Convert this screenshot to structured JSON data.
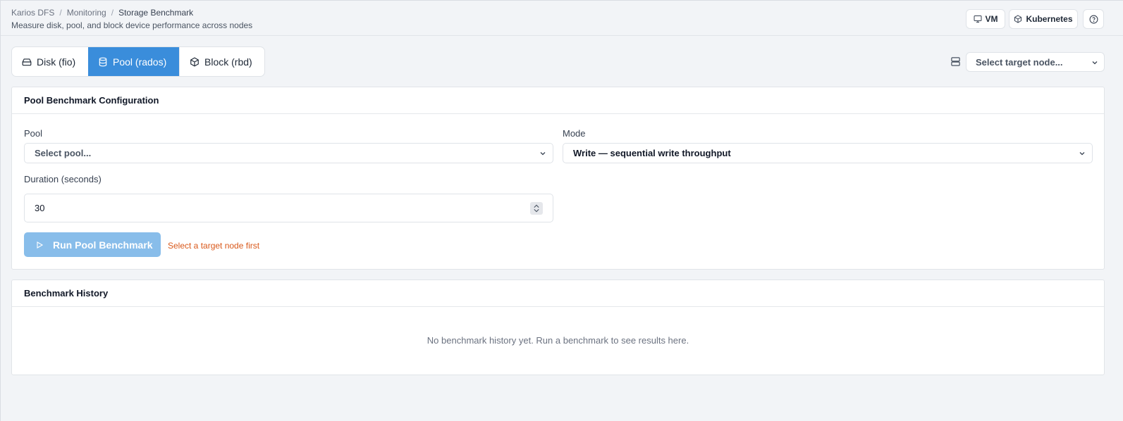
{
  "header": {
    "breadcrumb": [
      "Karios DFS",
      "Monitoring",
      "Storage Benchmark"
    ],
    "breadcrumb_separator": "/",
    "subtitle": "Measure disk, pool, and block device performance across nodes",
    "buttons": {
      "vm": "VM",
      "kubernetes": "Kubernetes"
    }
  },
  "tabs": [
    {
      "label": "Disk (fio)",
      "icon": "hard-drive-icon",
      "active": false
    },
    {
      "label": "Pool (rados)",
      "icon": "database-icon",
      "active": true
    },
    {
      "label": "Block (rbd)",
      "icon": "box-icon",
      "active": false
    }
  ],
  "node_selector": {
    "value": "Select target node...",
    "icon": "server-icon"
  },
  "config": {
    "title": "Pool Benchmark Configuration",
    "pool_label": "Pool",
    "pool_value": "Select pool...",
    "mode_label": "Mode",
    "mode_value": "Write — sequential write throughput",
    "duration_label": "Duration (seconds)",
    "duration_value": "30",
    "run_label": "Run Pool Benchmark",
    "hint": "Select a target node first"
  },
  "history": {
    "title": "Benchmark History",
    "empty_message": "No benchmark history yet. Run a benchmark to see results here."
  },
  "colors": {
    "accent": "#3a8ddb",
    "disabled_button": "#88bdea",
    "warning_text": "#d9581a",
    "background": "#f2f4f7"
  }
}
